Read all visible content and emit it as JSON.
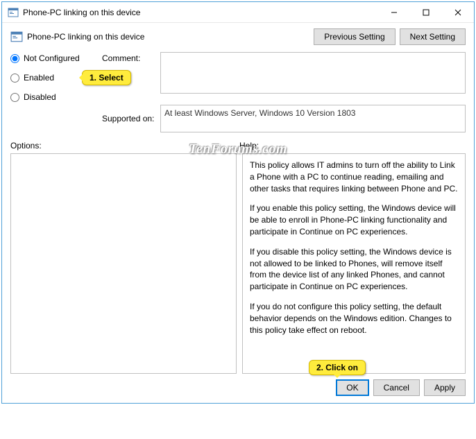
{
  "window": {
    "title": "Phone-PC linking on this device"
  },
  "heading": "Phone-PC linking on this device",
  "nav": {
    "previous": "Previous Setting",
    "next": "Next Setting"
  },
  "radios": {
    "not_configured": "Not Configured",
    "enabled": "Enabled",
    "disabled": "Disabled",
    "selected": "not_configured"
  },
  "labels": {
    "comment": "Comment:",
    "supported": "Supported on:",
    "options": "Options:",
    "help": "Help:"
  },
  "comment_value": "",
  "supported_value": "At least Windows Server, Windows 10 Version 1803",
  "help": {
    "p1": "This policy allows IT admins to turn off the ability to Link a Phone with a PC to continue reading, emailing and other tasks that requires linking between Phone and PC.",
    "p2": "If you enable this policy setting, the Windows device will be able to enroll in Phone-PC linking functionality and participate in Continue on PC experiences.",
    "p3": "If you disable this policy setting, the Windows device is not allowed to be linked to Phones, will remove itself from the device list of any linked Phones, and cannot participate in Continue on PC experiences.",
    "p4": "If you do not configure this policy setting, the default behavior depends on the Windows edition. Changes to this policy take effect on reboot."
  },
  "footer": {
    "ok": "OK",
    "cancel": "Cancel",
    "apply": "Apply"
  },
  "callouts": {
    "c1": "1. Select",
    "c2": "2. Click on"
  },
  "watermark": "TenForums.com"
}
